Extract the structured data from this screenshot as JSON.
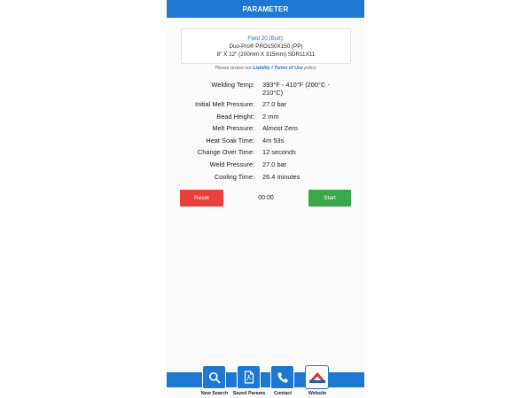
{
  "header": {
    "title": "PARAMETER"
  },
  "info": {
    "field": "Field 20 (Butt):",
    "product": "Duo-Pro® PRO150X150 (PP)",
    "size": "8\" X 12\" (200mm X 315mm) SDR11X11"
  },
  "policy": {
    "prefix": "Please review our",
    "link": "Liability / Terms of Use",
    "suffix": "policy"
  },
  "params": [
    {
      "label": "Welding Temp:",
      "value": "393°F - 410°F (200°C - 210°C)"
    },
    {
      "label": "Initial Melt Pressure:",
      "value": "27.0 bar"
    },
    {
      "label": "Bead Height:",
      "value": "2 mm"
    },
    {
      "label": "Melt Pressure:",
      "value": "Almost Zero"
    },
    {
      "label": "Heat Soak Time:",
      "value": "4m 53s"
    },
    {
      "label": "Change Over Time:",
      "value": "12 seconds"
    },
    {
      "label": "Weld Pressure:",
      "value": "27.0 bar"
    },
    {
      "label": "Cooling Time:",
      "value": "26.4 minutes"
    }
  ],
  "controls": {
    "reset_label": "Reset",
    "timer": "00:00",
    "start_label": "Start"
  },
  "nav": [
    {
      "label": "New Search",
      "icon": "search-icon"
    },
    {
      "label": "Saved Params",
      "icon": "pdf-document-icon"
    },
    {
      "label": "Contact",
      "icon": "phone-icon"
    },
    {
      "label": "Website",
      "icon": "company-logo-icon"
    }
  ],
  "colors": {
    "primary": "#1e78d2",
    "reset": "#e8403a",
    "start": "#38a84a"
  }
}
